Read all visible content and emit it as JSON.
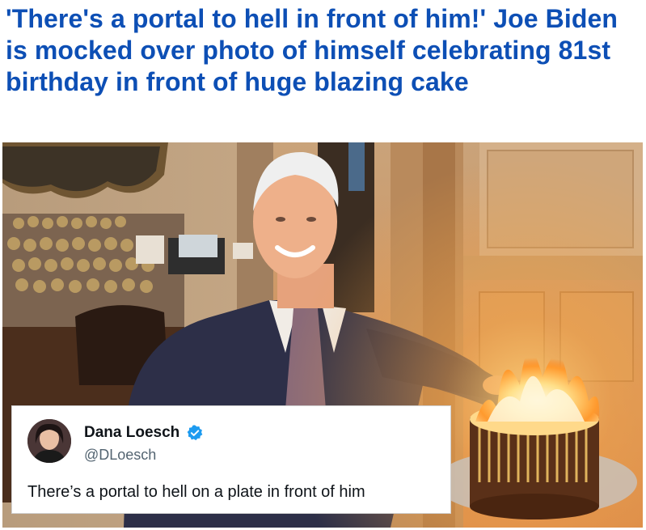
{
  "article": {
    "headline": "'There's a portal to hell in front of him!' Joe Biden is mocked over photo of himself celebrating 81st birthday in front of huge blazing cake"
  },
  "tweet": {
    "display_name": "Dana Loesch",
    "handle": "@DLoesch",
    "text": "There’s a portal to hell on a plate in front of him",
    "verified": true,
    "verified_badge_color": "#1d9bf0"
  },
  "colors": {
    "headline": "#0d4fb5"
  },
  "icons": {
    "verified": "verified-badge-icon"
  }
}
